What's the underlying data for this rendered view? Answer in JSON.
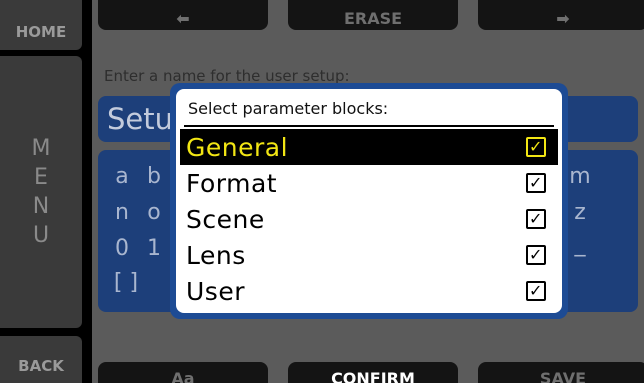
{
  "rail": {
    "home": "HOME",
    "menu_letters": [
      "M",
      "E",
      "N",
      "U"
    ],
    "back": "BACK"
  },
  "top_buttons": {
    "left_icon": "arrow-left-icon",
    "left_glyph": "⬅",
    "erase": "ERASE",
    "right_icon": "arrow-right-icon",
    "right_glyph": "➡"
  },
  "bottom_buttons": {
    "aa": "Aa",
    "confirm": "CONFIRM",
    "save": "SAVE"
  },
  "name_entry": {
    "prompt": "Enter a name for the user setup:",
    "value": "Setup"
  },
  "keyboard": {
    "row1": [
      "a",
      "b"
    ],
    "row1_end": "m",
    "row2": [
      "n",
      "o"
    ],
    "row2_end": "z",
    "row3": [
      "0",
      "1"
    ],
    "row3_end": "_",
    "row4": [
      "[ ]"
    ]
  },
  "dialog": {
    "title": "Select parameter blocks:",
    "options": [
      {
        "label": "General",
        "checked": true,
        "selected": true
      },
      {
        "label": "Format",
        "checked": true,
        "selected": false
      },
      {
        "label": "Scene",
        "checked": true,
        "selected": false
      },
      {
        "label": "Lens",
        "checked": true,
        "selected": false
      },
      {
        "label": "User",
        "checked": true,
        "selected": false
      }
    ],
    "check_glyph": "✓"
  },
  "colors": {
    "accent_blue": "#1d4b94",
    "field_blue": "#1d3f7a",
    "highlight_yellow": "#f2e614"
  }
}
